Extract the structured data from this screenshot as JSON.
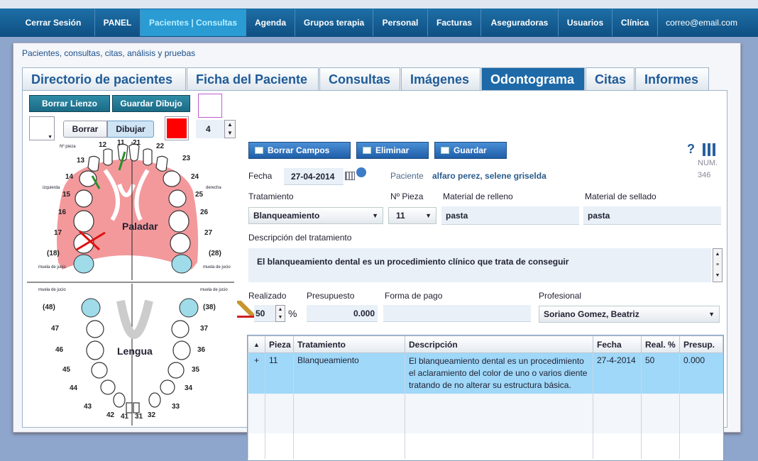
{
  "nav": {
    "logout": "Cerrar Sesión",
    "items": [
      "PANEL",
      "Pacientes | Consultas",
      "Agenda",
      "Grupos terapia",
      "Personal",
      "Facturas",
      "Aseguradoras",
      "Usuarios",
      "Clínica"
    ],
    "email": "correo@email.com"
  },
  "page": {
    "title": "Pacientes, consultas, citas, análisis y pruebas"
  },
  "tabs": [
    "Directorio de pacientes",
    "Ficha del Paciente",
    "Consultas",
    "Imágenes",
    "Odontograma",
    "Citas",
    "Informes"
  ],
  "drawing": {
    "clear_canvas": "Borrar Lienzo",
    "save_drawing": "Guardar Dibujo",
    "erase": "Borrar",
    "draw": "Dibujar",
    "brush_size": "4",
    "color": "#ff0000"
  },
  "odontogram": {
    "palate": "Paladar",
    "tongue": "Lengua",
    "piece_label": "Nº pieza",
    "left": "izquierda",
    "right": "derecha",
    "wisdom": "muela de jucio",
    "upper_teeth": [
      "11",
      "12",
      "13",
      "14",
      "15",
      "16",
      "17",
      "(18)",
      "21",
      "22",
      "23",
      "24",
      "25",
      "26",
      "27",
      "(28)"
    ],
    "lower_teeth": [
      "(48)",
      "47",
      "46",
      "45",
      "44",
      "43",
      "42",
      "41",
      "(38)",
      "37",
      "36",
      "35",
      "34",
      "33",
      "32",
      "31"
    ]
  },
  "toolbar": {
    "clear_fields": "Borrar Campos",
    "delete": "Eliminar",
    "save": "Guardar",
    "help": "?",
    "num_label": "NUM.",
    "num_value": "346"
  },
  "form": {
    "date_label": "Fecha",
    "date_value": "27-04-2014",
    "patient_label": "Paciente",
    "patient_value": "alfaro perez, selene griselda",
    "treatment_label": "Tratamiento",
    "treatment_value": "Blanqueamiento",
    "piece_label": "Nº Pieza",
    "piece_value": "11",
    "fill_label": "Material de relleno",
    "fill_value": "pasta",
    "seal_label": "Material de sellado",
    "seal_value": "pasta",
    "desc_label": "Descripción del tratamiento",
    "desc_value": "El blanqueamiento dental es un procedimiento clínico que trata de conseguir",
    "done_label": "Realizado",
    "done_value": "50",
    "percent": "%",
    "budget_label": "Presupuesto",
    "budget_value": "0.000",
    "payment_label": "Forma de pago",
    "payment_value": "",
    "pro_label": "Profesional",
    "pro_value": "Soriano Gomez, Beatriz"
  },
  "table": {
    "headers": [
      "▲",
      "Pieza",
      "Tratamiento",
      "Descripción",
      "Fecha",
      "Real. %",
      "Presup."
    ],
    "rows": [
      {
        "expand": "+",
        "piece": "11",
        "treatment": "Blanqueamiento",
        "desc1": "El blanqueamiento dental es un procedimiento",
        "desc2": "el aclaramiento del color de uno o varios diente",
        "desc3": "tratando de no alterar su estructura básica.",
        "date": "27-4-2014",
        "real": "50",
        "budget": "0.000"
      }
    ]
  }
}
